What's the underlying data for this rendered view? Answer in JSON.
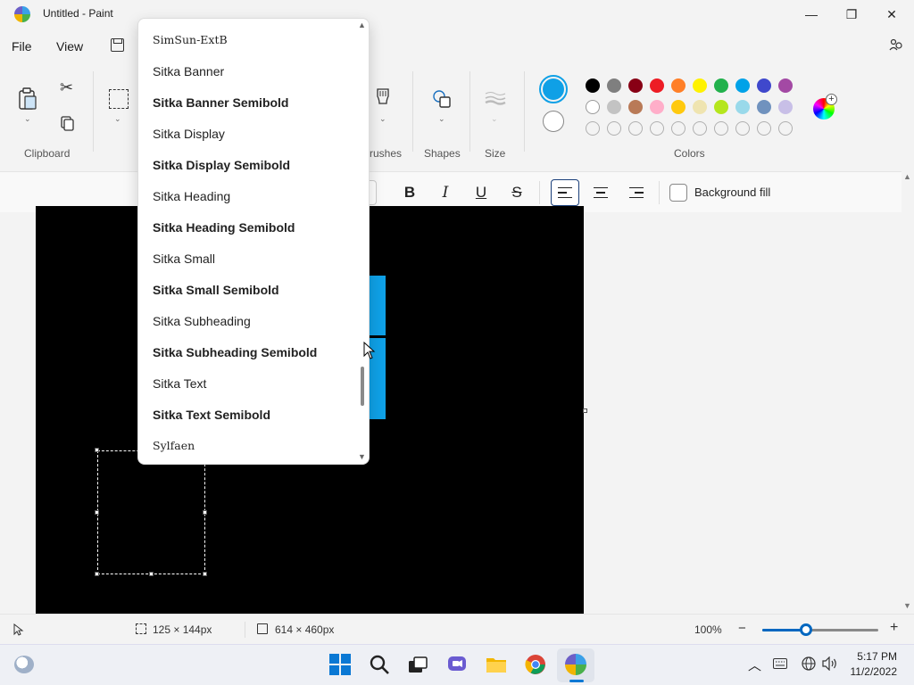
{
  "window": {
    "title": "Untitled - Paint",
    "minimize_glyph": "—",
    "maximize_glyph": "❐",
    "close_glyph": "✕"
  },
  "menu": {
    "file": "File",
    "view": "View"
  },
  "ribbon": {
    "clipboard_label": "Clipboard",
    "brushes_label": "rushes",
    "shapes_label": "Shapes",
    "size_label": "Size",
    "colors_label": "Colors"
  },
  "colors": {
    "primary": "#0fa0e6",
    "secondary": "#ffffff",
    "row1": [
      "#000000",
      "#7f7f7f",
      "#880015",
      "#ed1c24",
      "#ff7f27",
      "#fff200",
      "#22b14c",
      "#00a2e8",
      "#3f48cc",
      "#a349a4"
    ],
    "row2": [
      "#ffffff",
      "#c3c3c3",
      "#b97a57",
      "#ffaec9",
      "#ffc90e",
      "#efe4b0",
      "#b5e61d",
      "#99d9ea",
      "#7092be",
      "#c8bfe7"
    ]
  },
  "textbar": {
    "bold": "B",
    "italic": "I",
    "underline": "U",
    "strike": "S",
    "background_fill": "Background fill"
  },
  "font_dropdown": {
    "items": [
      {
        "label": "SimSun-ExtB",
        "weight": "serif"
      },
      {
        "label": "Sitka Banner",
        "weight": "regular"
      },
      {
        "label": "Sitka Banner Semibold",
        "weight": "semibold"
      },
      {
        "label": "Sitka Display",
        "weight": "regular"
      },
      {
        "label": "Sitka Display Semibold",
        "weight": "semibold"
      },
      {
        "label": "Sitka Heading",
        "weight": "regular"
      },
      {
        "label": "Sitka Heading Semibold",
        "weight": "semibold"
      },
      {
        "label": "Sitka Small",
        "weight": "regular"
      },
      {
        "label": "Sitka Small Semibold",
        "weight": "semibold"
      },
      {
        "label": "Sitka Subheading",
        "weight": "regular"
      },
      {
        "label": "Sitka Subheading Semibold",
        "weight": "semibold"
      },
      {
        "label": "Sitka Text",
        "weight": "regular"
      },
      {
        "label": "Sitka Text Semibold",
        "weight": "semibold"
      },
      {
        "label": "Sylfaen",
        "weight": "serif"
      }
    ]
  },
  "status": {
    "selection_size": "125 × 144px",
    "canvas_size": "614 × 460px",
    "zoom": "100%",
    "zoom_minus": "−",
    "zoom_plus": "+",
    "zoom_level": 0.38
  },
  "taskbar": {
    "time": "5:17 PM",
    "date": "11/2/2022"
  }
}
